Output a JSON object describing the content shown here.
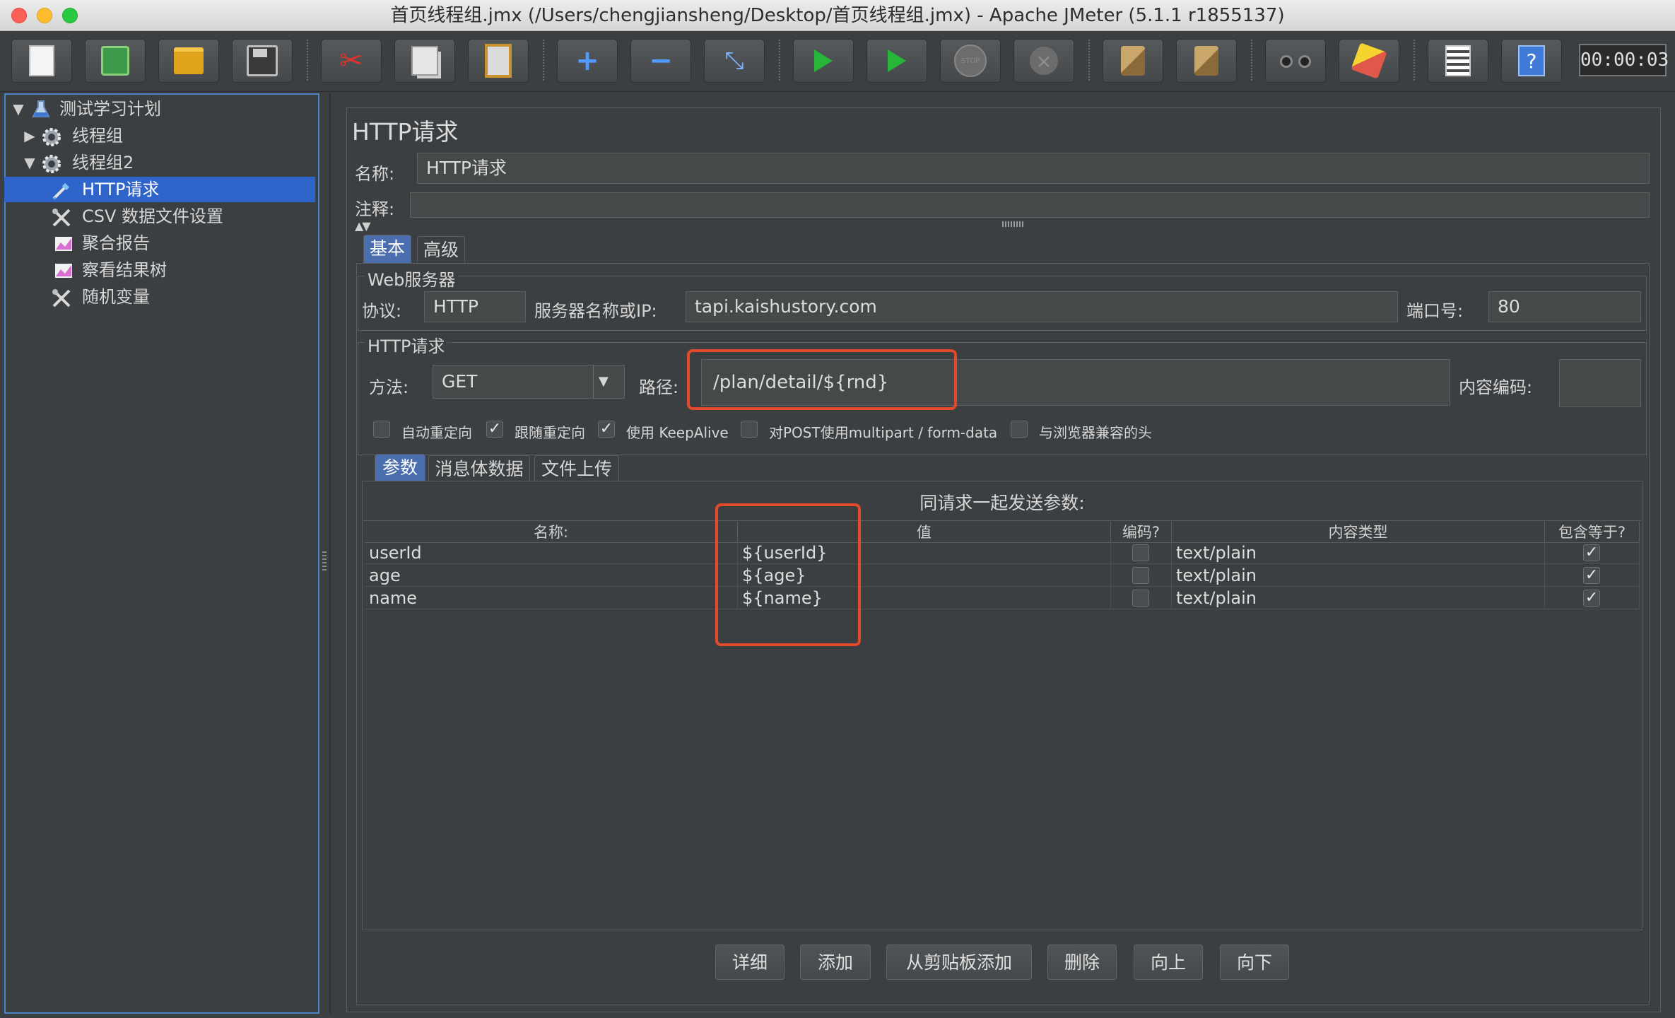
{
  "window": {
    "title": "首页线程组.jmx (/Users/chengjiansheng/Desktop/首页线程组.jmx) - Apache JMeter (5.1.1 r1855137)",
    "timer": "00:00:03"
  },
  "toolbar": {
    "icons": [
      "new-icon",
      "templates-icon",
      "open-icon",
      "save-icon",
      "cut-icon",
      "copy-icon",
      "paste-icon",
      "expand-icon",
      "collapse-icon",
      "toggle-icon",
      "start-icon",
      "start-no-pauses-icon",
      "stop-icon",
      "shutdown-icon",
      "clear-icon",
      "clear-all-icon",
      "search-icon",
      "reset-search-icon",
      "function-helper-icon",
      "help-icon"
    ],
    "stop_text": "STOP"
  },
  "tree": {
    "items": [
      {
        "label": "测试学习计划",
        "icon": "flask-icon",
        "expanded": true
      },
      {
        "label": "线程组",
        "icon": "gear-icon",
        "expanded": false
      },
      {
        "label": "线程组2",
        "icon": "gear-icon",
        "expanded": true
      },
      {
        "label": "HTTP请求",
        "icon": "pipette-icon",
        "selected": true
      },
      {
        "label": "CSV 数据文件设置",
        "icon": "wrench-icon"
      },
      {
        "label": "聚合报告",
        "icon": "chart-icon"
      },
      {
        "label": "察看结果树",
        "icon": "chart-icon"
      },
      {
        "label": "随机变量",
        "icon": "wrench-icon"
      }
    ]
  },
  "panel": {
    "title": "HTTP请求",
    "name_label": "名称:",
    "name_value": "HTTP请求",
    "comment_label": "注释:",
    "comment_value": "",
    "tabs": {
      "basic": "基本",
      "advanced": "高级"
    },
    "web_server": {
      "legend": "Web服务器",
      "protocol_label": "协议:",
      "protocol_value": "HTTP",
      "server_label": "服务器名称或IP:",
      "server_value": "tapi.kaishustory.com",
      "port_label": "端口号:",
      "port_value": "80"
    },
    "http_request": {
      "legend": "HTTP请求",
      "method_label": "方法:",
      "method_value": "GET",
      "path_label": "路径:",
      "path_value": "/plan/detail/${rnd}",
      "encoding_label": "内容编码:",
      "encoding_value": ""
    },
    "options": [
      {
        "label": "自动重定向",
        "checked": false
      },
      {
        "label": "跟随重定向",
        "checked": true
      },
      {
        "label": "使用 KeepAlive",
        "checked": true
      },
      {
        "label": "对POST使用multipart / form-data",
        "checked": false
      },
      {
        "label": "与浏览器兼容的头",
        "checked": false
      }
    ],
    "sub_tabs": {
      "params": "参数",
      "body": "消息体数据",
      "files": "文件上传"
    },
    "params_caption": "同请求一起发送参数:",
    "columns": [
      "名称:",
      "值",
      "编码?",
      "内容类型",
      "包含等于?"
    ],
    "rows": [
      {
        "name": "userId",
        "value": "${userId}",
        "encode": false,
        "content_type": "text/plain",
        "include_equals": true
      },
      {
        "name": "age",
        "value": "${age}",
        "encode": false,
        "content_type": "text/plain",
        "include_equals": true
      },
      {
        "name": "name",
        "value": "${name}",
        "encode": false,
        "content_type": "text/plain",
        "include_equals": true
      }
    ],
    "buttons": {
      "detail": "详细",
      "add": "添加",
      "add_from_clipboard": "从剪贴板添加",
      "delete": "删除",
      "up": "向上",
      "down": "向下"
    }
  },
  "colors": {
    "highlight_box": "#e24a2b",
    "selection": "#2f65ca",
    "active_tab": "#4b6eaf"
  }
}
